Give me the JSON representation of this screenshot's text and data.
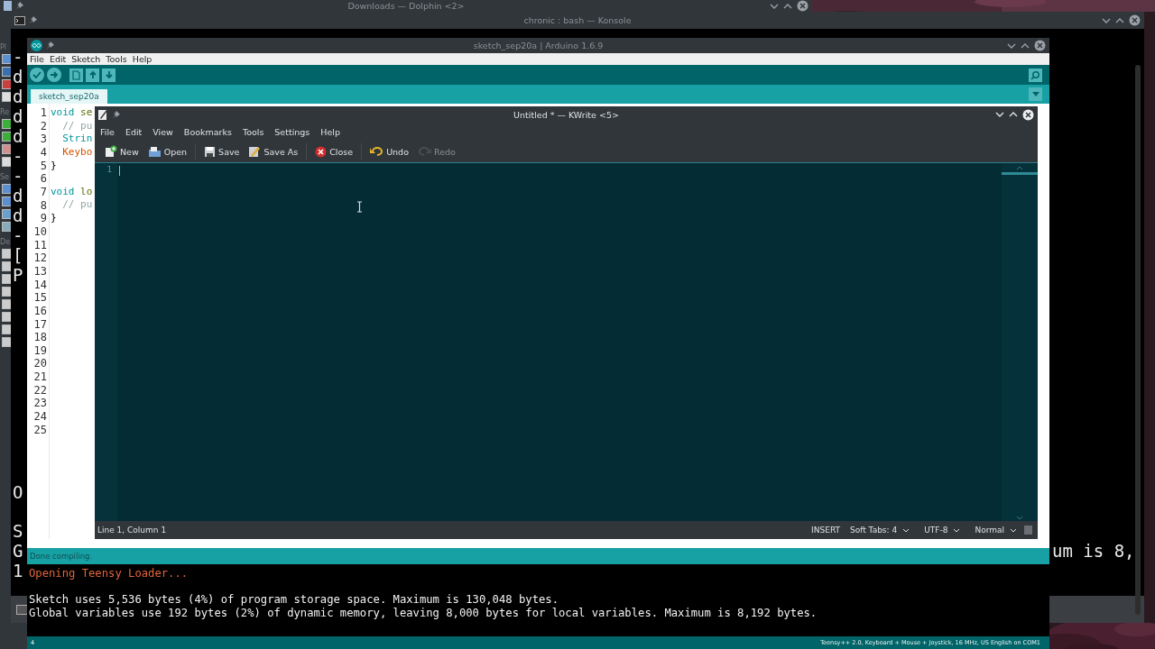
{
  "dolphin": {
    "title": "Downloads — Dolphin <2>",
    "sidebar_labels": [
      "Pl",
      "Re",
      "Se",
      "De"
    ]
  },
  "konsole": {
    "title": "chronic : bash — Konsole",
    "blocks": [
      [
        "-",
        "d",
        "d",
        "d",
        "d",
        "-",
        "-",
        "d",
        "d",
        "-",
        "[",
        "P"
      ],
      [
        "O"
      ],
      [
        "S",
        "G",
        "1"
      ]
    ],
    "right_fragment": "um is 8,"
  },
  "arduino": {
    "title": "sketch_sep20a | Arduino 1.6.9",
    "menu": [
      "File",
      "Edit",
      "Sketch",
      "Tools",
      "Help"
    ],
    "tab": {
      "label": "sketch_sep20a",
      "selected": true
    },
    "code_lines": [
      {
        "number": "1",
        "tokens": [
          {
            "text": "void",
            "kind": "keyword"
          },
          {
            "text": " se",
            "kind": "function"
          }
        ]
      },
      {
        "number": "2",
        "tokens": [
          {
            "text": "  // pu",
            "kind": "comment"
          }
        ]
      },
      {
        "number": "3",
        "tokens": [
          {
            "text": "  Strin",
            "kind": "type"
          }
        ]
      },
      {
        "number": "4",
        "tokens": [
          {
            "text": "  Keybo",
            "kind": "class"
          }
        ]
      },
      {
        "number": "5",
        "tokens": [
          {
            "text": "}",
            "kind": "plain"
          }
        ]
      },
      {
        "number": "6"
      },
      {
        "number": "7",
        "tokens": [
          {
            "text": "void",
            "kind": "keyword"
          },
          {
            "text": " lo",
            "kind": "function"
          }
        ]
      },
      {
        "number": "8",
        "tokens": [
          {
            "text": "  // pu",
            "kind": "comment"
          }
        ]
      },
      {
        "number": "9",
        "tokens": [
          {
            "text": "}",
            "kind": "plain"
          }
        ]
      },
      {
        "number": "10"
      },
      {
        "number": "11"
      },
      {
        "number": "12"
      },
      {
        "number": "13"
      },
      {
        "number": "14"
      },
      {
        "number": "15"
      },
      {
        "number": "16"
      },
      {
        "number": "17"
      },
      {
        "number": "18"
      },
      {
        "number": "19"
      },
      {
        "number": "20"
      },
      {
        "number": "21"
      },
      {
        "number": "22"
      },
      {
        "number": "23"
      },
      {
        "number": "24"
      },
      {
        "number": "25"
      }
    ],
    "status": "Done compiling.",
    "console": [
      {
        "text": "Opening Teensy Loader...",
        "kind": "notice"
      },
      {
        "text": "Sketch uses 5,536 bytes (4%) of program storage space. Maximum is 130,048 bytes.",
        "kind": "plain"
      },
      {
        "text": "Global variables use 192 bytes (2%) of dynamic memory, leaving 8,000 bytes for local variables. Maximum is 8,192 bytes.",
        "kind": "plain"
      }
    ],
    "line_indicator": "4",
    "board": "Teensy++ 2.0, Keyboard + Mouse + Joystick, 16 MHz, US English on COM1"
  },
  "kwrite": {
    "title": "Untitled * — KWrite <5>",
    "menu": [
      "File",
      "Edit",
      "View",
      "Bookmarks",
      "Tools",
      "Settings",
      "Help"
    ],
    "toolbar": [
      {
        "label": "New",
        "kind": "new",
        "disabled": false
      },
      {
        "label": "Open",
        "kind": "open",
        "disabled": false
      },
      {
        "label": "Save",
        "kind": "save",
        "disabled": false
      },
      {
        "label": "Save As",
        "kind": "saveas",
        "disabled": false
      },
      {
        "label": "Close",
        "kind": "close",
        "disabled": false
      },
      {
        "label": "Undo",
        "kind": "undo",
        "disabled": false
      },
      {
        "label": "Redo",
        "kind": "redo",
        "disabled": true
      }
    ],
    "line_number": "1",
    "position": "Line 1, Column 1",
    "mode": "INSERT",
    "indent": "Soft Tabs: 4",
    "encoding": "UTF-8",
    "input_mode": "Normal"
  }
}
